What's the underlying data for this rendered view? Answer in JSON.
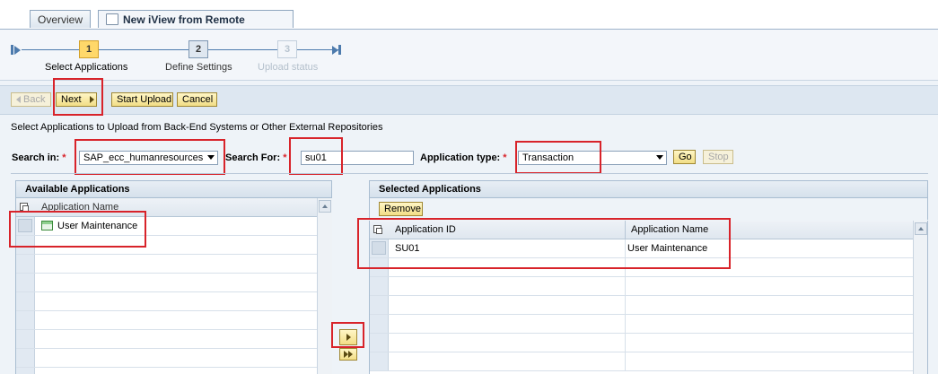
{
  "tabs": [
    {
      "label": "Overview"
    },
    {
      "label": "New iView from Remote Source",
      "close": "×"
    }
  ],
  "roadmap": {
    "steps": [
      {
        "number": "1",
        "label": "Select Applications",
        "state": "current"
      },
      {
        "number": "2",
        "label": "Define Settings",
        "state": "next"
      },
      {
        "number": "3",
        "label": "Upload status",
        "state": "disabled"
      }
    ]
  },
  "toolbar": {
    "back_label": "Back",
    "next_label": "Next",
    "start_upload_label": "Start Upload",
    "cancel_label": "Cancel"
  },
  "instruction": "Select Applications to Upload from Back-End Systems or Other External Repositories",
  "search": {
    "search_in_label": "Search in:",
    "search_in_value": "SAP_ecc_humanresources",
    "search_for_label": "Search For:",
    "search_for_value": "su01",
    "app_type_label": "Application type:",
    "app_type_value": "Transaction",
    "required_mark": "*",
    "go_label": "Go",
    "stop_label": "Stop"
  },
  "available": {
    "title": "Available Applications",
    "column": "Application Name",
    "rows": [
      {
        "name": "User Maintenance"
      }
    ]
  },
  "selected": {
    "title": "Selected Applications",
    "remove_label": "Remove",
    "columns": [
      "Application ID",
      "Application Name"
    ],
    "rows": [
      {
        "id": "SU01",
        "name": "User Maintenance"
      }
    ]
  },
  "colors": {
    "highlight_red": "#d8232a",
    "button_yellow": "#f2de86",
    "roadmap_current": "#ffd86a"
  }
}
